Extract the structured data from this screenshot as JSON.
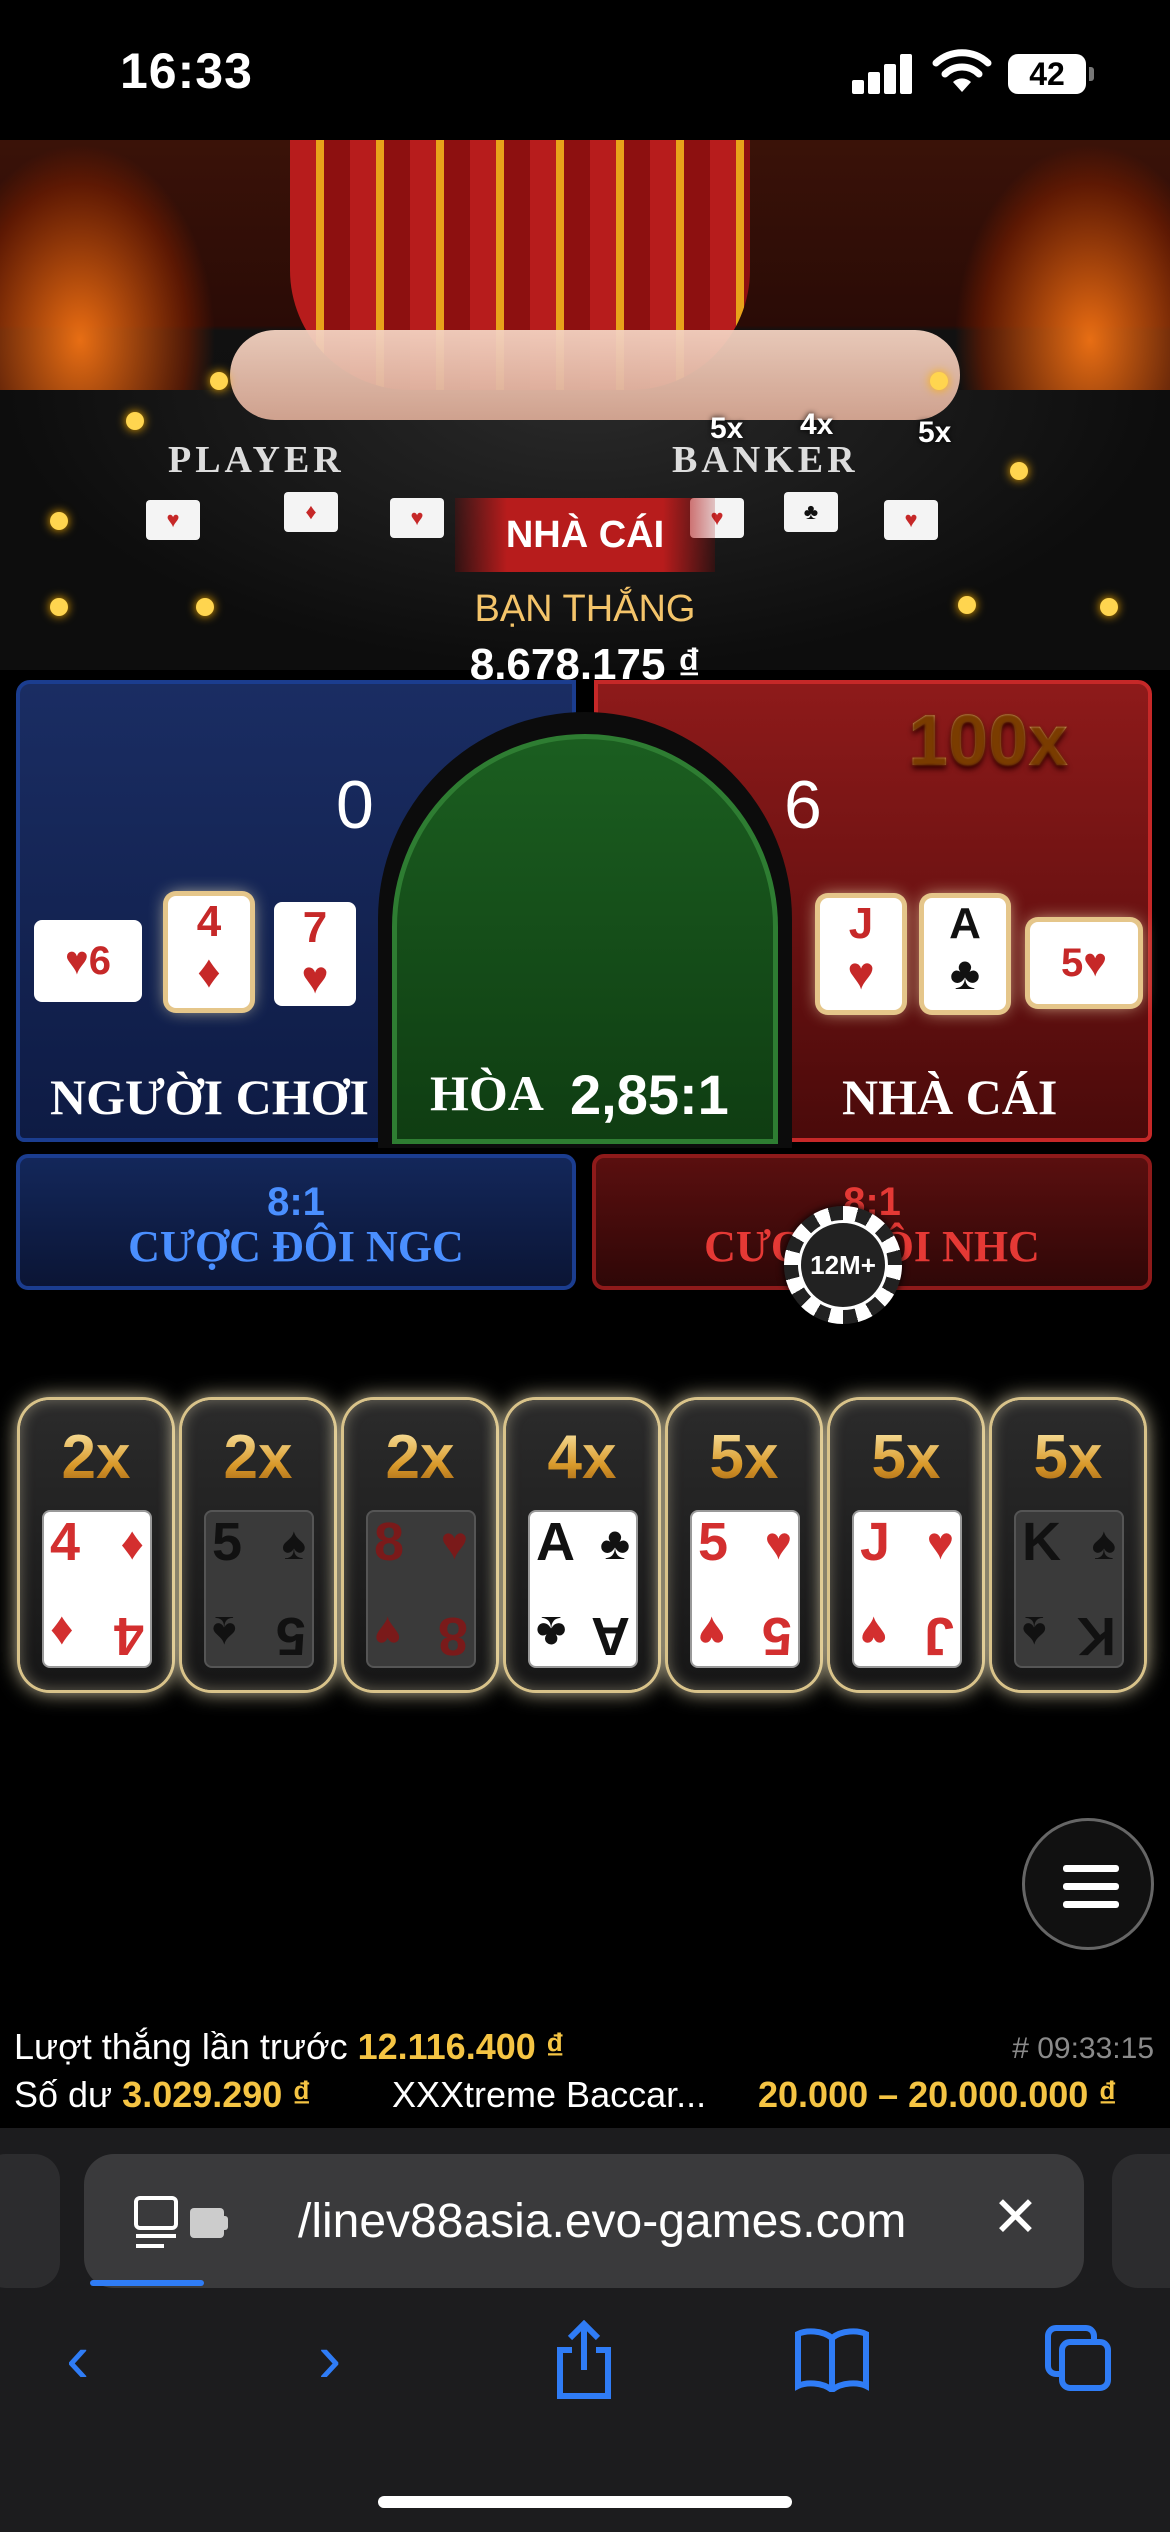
{
  "status_bar": {
    "time": "16:33",
    "battery": "42"
  },
  "video": {
    "player_label": "PLAYER",
    "banker_label": "BANKER",
    "table_mults": [
      "5x",
      "4x",
      "5x"
    ],
    "result_banner": "NHÀ CÁI",
    "win_label": "BẠN THẮNG",
    "win_amount": "8.678.175 ₫"
  },
  "bet_area": {
    "player": {
      "score": "0",
      "label": "NGƯỜI CHƠI",
      "cards": [
        {
          "rank": "6",
          "suit": "♥"
        },
        {
          "rank": "4",
          "suit": "♦"
        },
        {
          "rank": "7",
          "suit": "♥"
        }
      ]
    },
    "tie": {
      "label": "HÒA",
      "odds": "2,85:1"
    },
    "banker": {
      "score": "6",
      "label": "NHÀ CÁI",
      "multiplier": "100x",
      "cards": [
        {
          "rank": "J",
          "suit": "♥"
        },
        {
          "rank": "A",
          "suit": "♣"
        },
        {
          "rank": "5",
          "suit": "♥"
        }
      ]
    },
    "player_pair": {
      "odds": "8:1",
      "label": "CƯỢC ĐÔI NGC"
    },
    "banker_pair": {
      "odds": "8:1",
      "label": "CƯỢC ĐÔI NHC"
    },
    "chip": "12M+"
  },
  "multiplier_cards": [
    {
      "mult": "2x",
      "rank": "4",
      "suit": "♦",
      "color": "red",
      "active": true
    },
    {
      "mult": "2x",
      "rank": "5",
      "suit": "♠",
      "color": "black",
      "active": false
    },
    {
      "mult": "2x",
      "rank": "8",
      "suit": "♥",
      "color": "red",
      "active": false
    },
    {
      "mult": "4x",
      "rank": "A",
      "suit": "♣",
      "color": "black",
      "active": true
    },
    {
      "mult": "5x",
      "rank": "5",
      "suit": "♥",
      "color": "red",
      "active": true
    },
    {
      "mult": "5x",
      "rank": "J",
      "suit": "♥",
      "color": "red",
      "active": true
    },
    {
      "mult": "5x",
      "rank": "K",
      "suit": "♠",
      "color": "black",
      "active": false
    }
  ],
  "info": {
    "last_win_label": "Lượt thắng lần trước",
    "last_win_value": "12.116.400 ₫",
    "round_id": "# 09:33:15",
    "balance_label": "Số dư",
    "balance_value": "3.029.290 ₫",
    "game_name": "XXXtreme Baccar...",
    "bet_limits": "20.000 – 20.000.000 ₫"
  },
  "browser": {
    "url": "/linev88asia.evo-games.com",
    "nav": {
      "back": "‹",
      "forward": "›"
    }
  },
  "colors": {
    "player": "#1b3d8f",
    "banker": "#c62828",
    "tie": "#2e7d32",
    "gold": "#f5c443",
    "link": "#2f7cf6"
  }
}
